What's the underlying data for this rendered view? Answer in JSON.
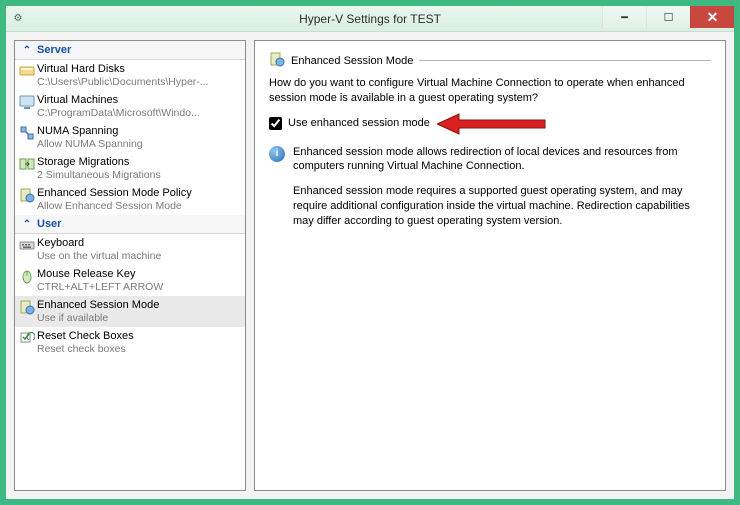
{
  "window": {
    "title": "Hyper-V Settings for TEST"
  },
  "nav": {
    "sections": [
      {
        "label": "Server",
        "items": [
          {
            "label": "Virtual Hard Disks",
            "sub": "C:\\Users\\Public\\Documents\\Hyper-..."
          },
          {
            "label": "Virtual Machines",
            "sub": "C:\\ProgramData\\Microsoft\\Windo..."
          },
          {
            "label": "NUMA Spanning",
            "sub": "Allow NUMA Spanning"
          },
          {
            "label": "Storage Migrations",
            "sub": "2 Simultaneous Migrations"
          },
          {
            "label": "Enhanced Session Mode Policy",
            "sub": "Allow Enhanced Session Mode"
          }
        ]
      },
      {
        "label": "User",
        "items": [
          {
            "label": "Keyboard",
            "sub": "Use on the virtual machine"
          },
          {
            "label": "Mouse Release Key",
            "sub": "CTRL+ALT+LEFT ARROW"
          },
          {
            "label": "Enhanced Session Mode",
            "sub": "Use if available",
            "selected": true
          },
          {
            "label": "Reset Check Boxes",
            "sub": "Reset check boxes"
          }
        ]
      }
    ]
  },
  "detail": {
    "title": "Enhanced Session Mode",
    "question": "How do you want to configure Virtual Machine Connection to operate when enhanced session mode is available in a guest operating system?",
    "checkbox_label": "Use enhanced session mode",
    "checkbox_checked": true,
    "info_para1": "Enhanced session mode allows redirection of local devices and resources from computers running Virtual Machine Connection.",
    "info_para2": "Enhanced session mode requires a supported guest operating system, and may require additional configuration inside the virtual machine. Redirection capabilities may differ according to guest operating system version."
  }
}
